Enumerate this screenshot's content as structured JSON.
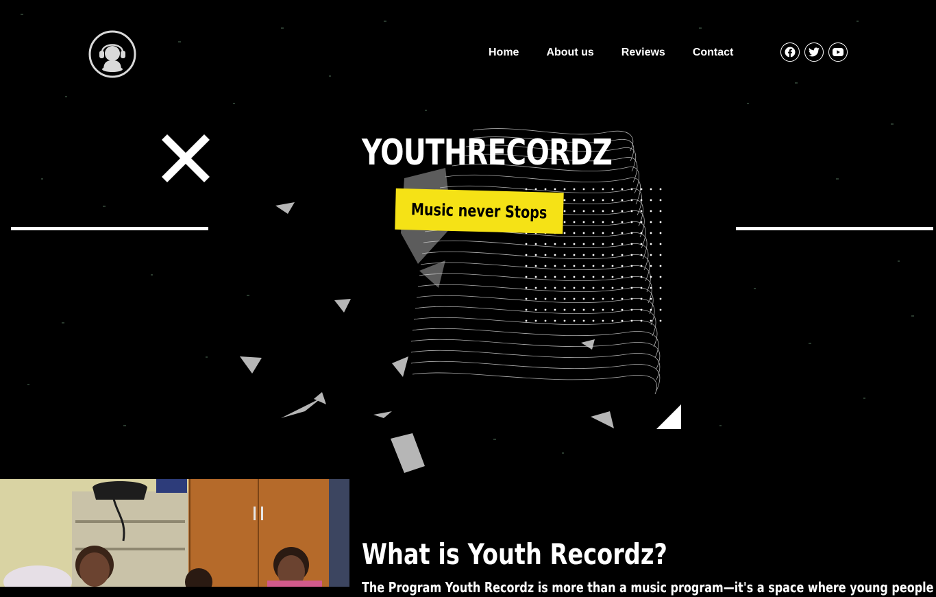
{
  "nav": {
    "items": [
      "Home",
      "About us",
      "Reviews",
      "Contact"
    ]
  },
  "social": {
    "icons": [
      "facebook-icon",
      "twitter-icon",
      "youtube-icon"
    ]
  },
  "hero": {
    "brand": "YOUTHRECORDZ",
    "cta_label": "Music never Stops"
  },
  "about": {
    "title": "What is Youth Recordz?",
    "text": "The Program Youth Recordz is more than a music program—it's a space where young people can"
  },
  "colors": {
    "background": "#000000",
    "accent": "#f5e216",
    "text": "#ffffff"
  }
}
